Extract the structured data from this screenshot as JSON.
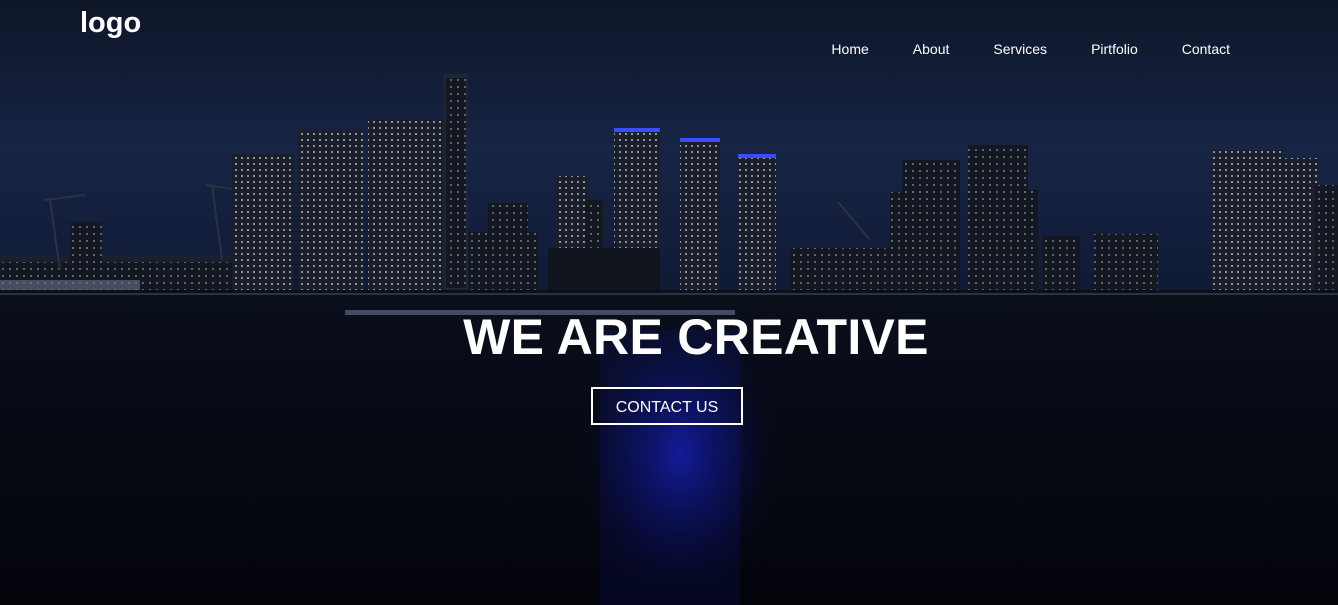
{
  "header": {
    "logo_text": "logo",
    "nav": [
      {
        "label": "Home"
      },
      {
        "label": "About"
      },
      {
        "label": "Services"
      },
      {
        "label": "Pirtfolio"
      },
      {
        "label": "Contact"
      }
    ]
  },
  "hero": {
    "title": "WE ARE CREATIVE",
    "cta_label": "CONTACT US",
    "background": "night-city-skyline-over-water"
  },
  "colors": {
    "text": "#ffffff",
    "sky": "#131d36",
    "water": "#04060c",
    "reflection": "#1a2bff"
  }
}
